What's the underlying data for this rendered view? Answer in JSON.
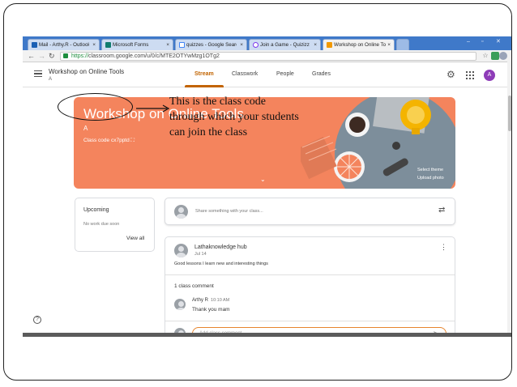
{
  "browser": {
    "tabs": [
      {
        "label": "Mail - Arthy.R - Outlook",
        "color": "#1a5fb4"
      },
      {
        "label": "Microsoft Forms",
        "color": "#107c6f"
      },
      {
        "label": "quizzes - Google Search",
        "color": "#ffffff"
      },
      {
        "label": "Join a Game - Quizizz",
        "color": "#7c3aed"
      },
      {
        "label": "Workshop on Online Tools",
        "color": "#f29900"
      }
    ],
    "close_glyph": "×",
    "url_protocol": "https://",
    "url_rest": "classroom.google.com/u/0/c/MTE2OTYwMzg1OTg2"
  },
  "app": {
    "class_title": "Workshop on Online Tools",
    "class_section": "A",
    "nav_tabs": [
      "Stream",
      "Classwork",
      "People",
      "Grades"
    ],
    "active_tab": "Stream",
    "avatar_letter": "A",
    "accent_color": "#c26401",
    "avatar_color": "#8e3cb8"
  },
  "banner": {
    "title": "Workshop on Online Tools",
    "section": "A",
    "class_code_text": "Class code  cx7pptd",
    "select_theme": "Select theme",
    "upload_photo": "Upload photo",
    "color": "#f4845d"
  },
  "annotation": {
    "text": "This is the class code through which your students can join the class"
  },
  "upcoming": {
    "heading": "Upcoming",
    "empty": "No work due soon",
    "view_all": "View all"
  },
  "share": {
    "placeholder": "Share something with your class..."
  },
  "post": {
    "author": "Lathaknowledge hub",
    "date": "Jul 14",
    "body": "Good lessons I learn new and interesting things",
    "comment_count": "1 class comment",
    "comment": {
      "author": "Arthy R",
      "time": "10:10 AM",
      "text": "Thank you mam"
    },
    "comment_placeholder": "Add class comment..."
  }
}
